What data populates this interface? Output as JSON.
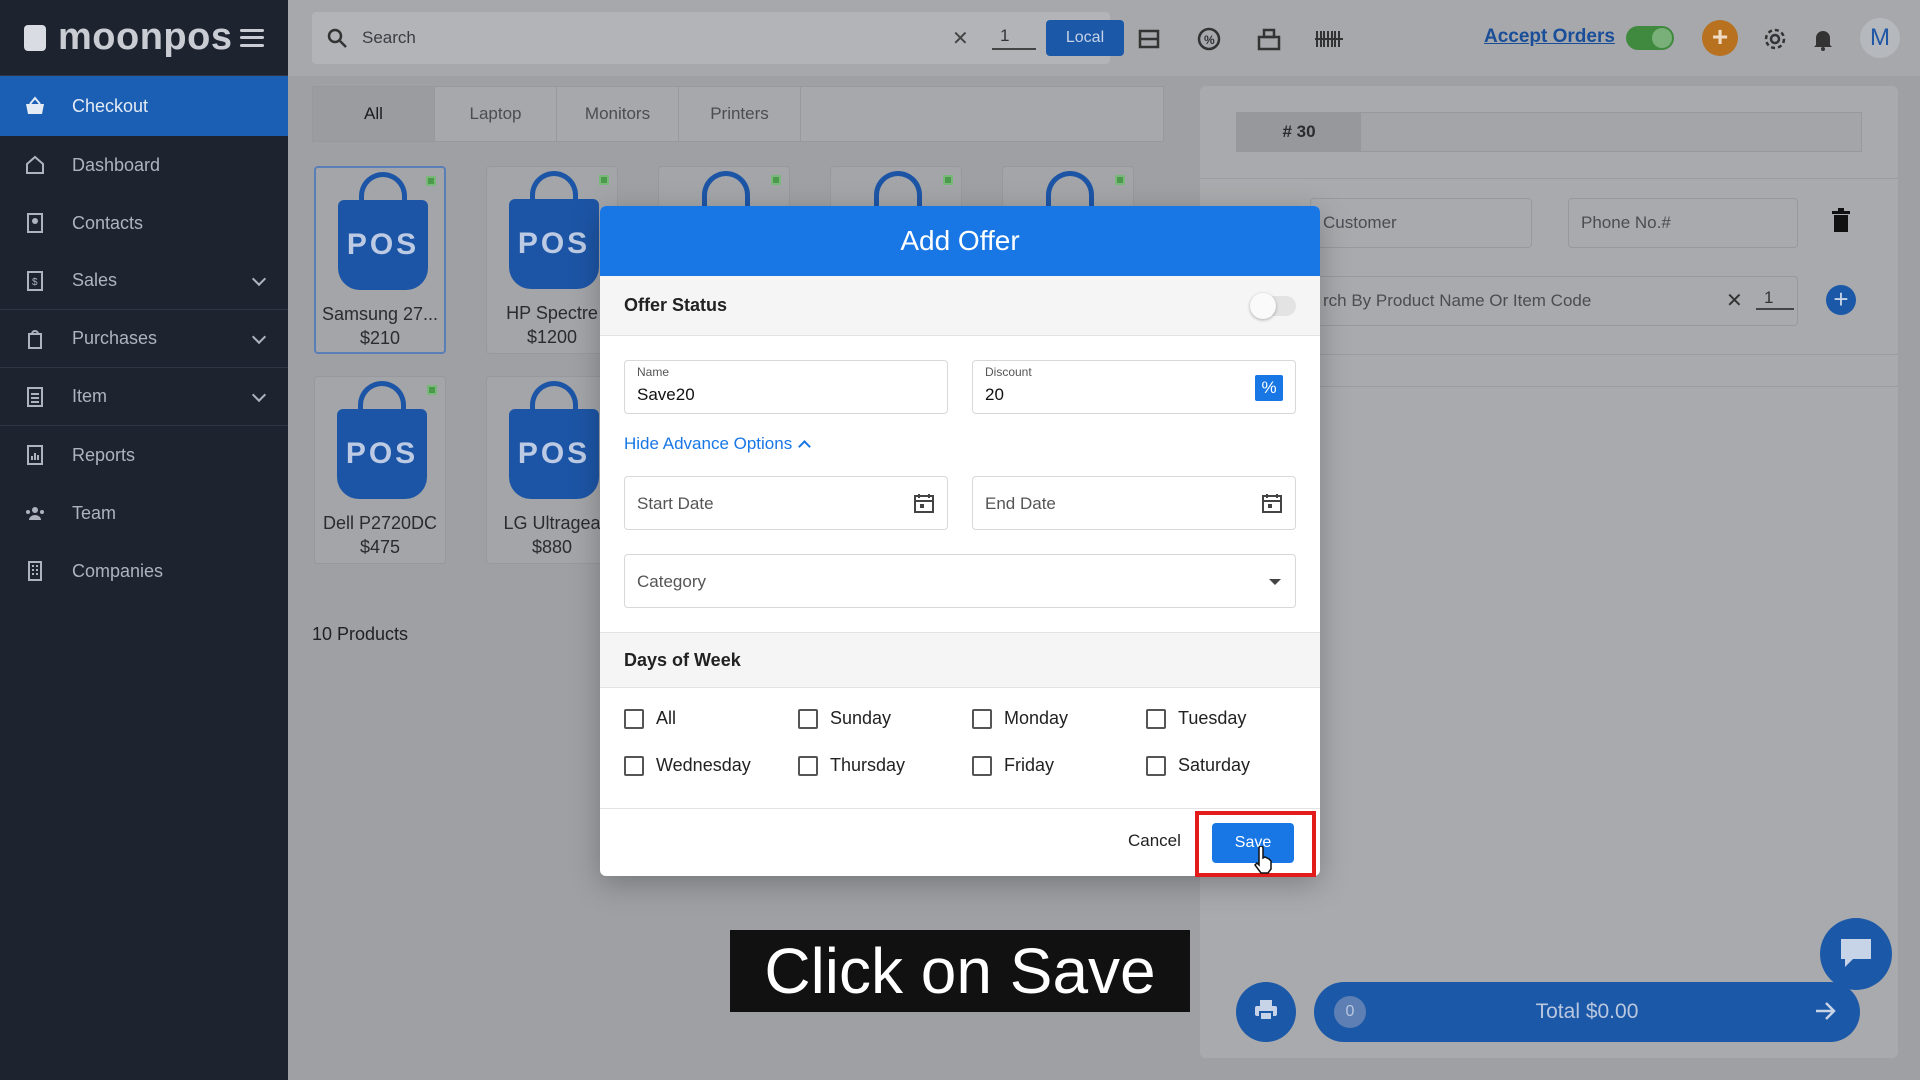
{
  "sidebar": {
    "brand": "moonpos",
    "items": [
      {
        "label": "Checkout",
        "icon": "basket-icon"
      },
      {
        "label": "Dashboard",
        "icon": "home-icon"
      },
      {
        "label": "Contacts",
        "icon": "contacts-icon"
      },
      {
        "label": "Sales",
        "icon": "sales-icon"
      },
      {
        "label": "Purchases",
        "icon": "purchases-icon"
      },
      {
        "label": "Item",
        "icon": "item-icon"
      },
      {
        "label": "Reports",
        "icon": "reports-icon"
      },
      {
        "label": "Team",
        "icon": "team-icon"
      },
      {
        "label": "Companies",
        "icon": "companies-icon"
      }
    ]
  },
  "topbar": {
    "search_placeholder": "Search",
    "quantity": "1",
    "local_label": "Local",
    "accept_orders_label": "Accept Orders",
    "avatar_initial": "M"
  },
  "categories": [
    "All",
    "Laptop",
    "Monitors",
    "Printers"
  ],
  "products": [
    {
      "name": "Samsung 27...",
      "price": "$210",
      "bag_text": "POS"
    },
    {
      "name": "HP Spectre",
      "price": "$1200",
      "bag_text": "POS"
    },
    {
      "name": "Dell P2720DC",
      "price": "$475",
      "bag_text": "POS"
    },
    {
      "name": "LG Ultragea",
      "price": "$880",
      "bag_text": "POS"
    }
  ],
  "products_count": "10 Products",
  "cart": {
    "order_tab": "# 30",
    "customer_placeholder": "Customer",
    "phone_placeholder": "Phone No.#",
    "product_search_placeholder": "rch By Product Name Or Item Code",
    "quantity": "1",
    "count": "0",
    "total_label": "Total $0.00"
  },
  "modal": {
    "title": "Add Offer",
    "offer_status_label": "Offer Status",
    "name_label": "Name",
    "name_value": "Save20",
    "discount_label": "Discount",
    "discount_value": "20",
    "percent_symbol": "%",
    "advance_options_label": "Hide Advance Options",
    "start_date_placeholder": "Start Date",
    "end_date_placeholder": "End Date",
    "category_placeholder": "Category",
    "days_heading": "Days of Week",
    "days": [
      "All",
      "Sunday",
      "Monday",
      "Tuesday",
      "Wednesday",
      "Thursday",
      "Friday",
      "Saturday"
    ],
    "cancel_label": "Cancel",
    "save_label": "Save"
  },
  "caption": "Click on Save",
  "colors": {
    "accent": "#1877e5",
    "highlight": "#e21b1b",
    "sidebar": "#1e2330"
  }
}
